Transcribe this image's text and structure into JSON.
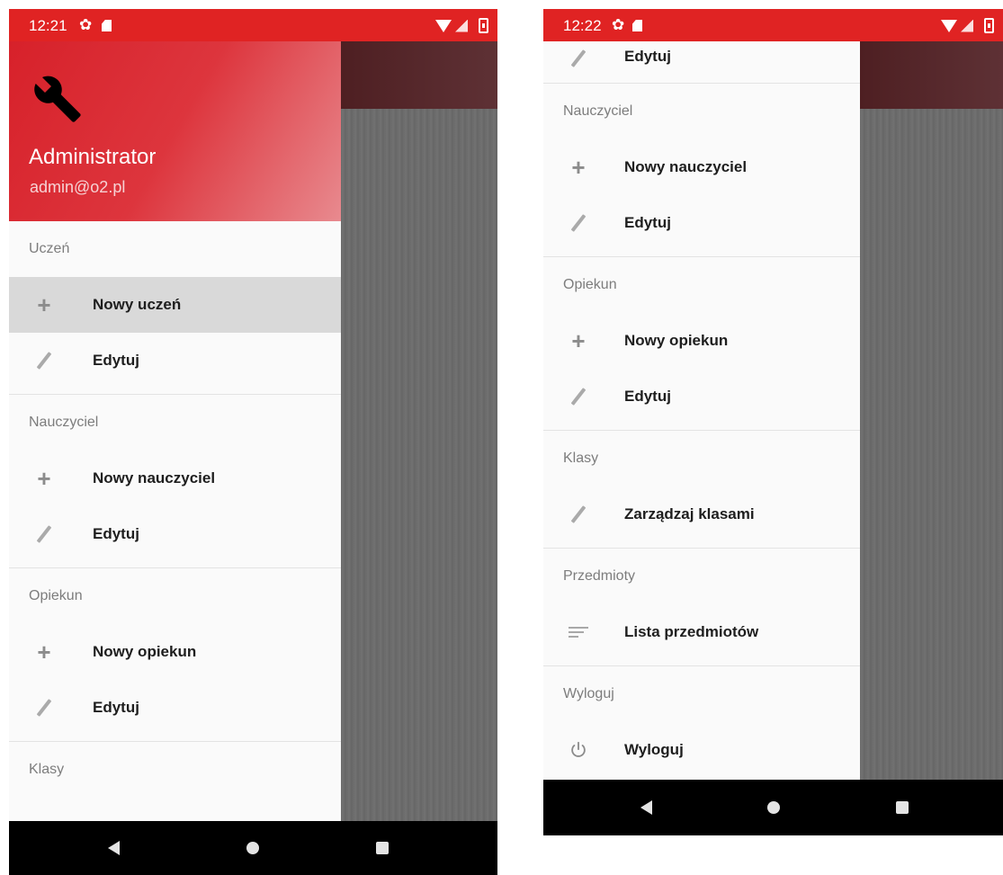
{
  "colors": {
    "status_bar": "#e02323",
    "header_start": "#d7212a",
    "header_end": "#e88a8f",
    "drawer_bg": "#fafafa",
    "selected_item": "#d9d9d9",
    "app_toolbar": "#5e3135",
    "nav_bar": "#000000"
  },
  "left": {
    "status": {
      "time": "12:21",
      "icons": [
        "gear-icon",
        "sd-card-icon",
        "wifi-icon",
        "signal-icon",
        "battery-icon"
      ]
    },
    "header": {
      "icon": "wrench-icon",
      "user_name": "Administrator",
      "user_email": "admin@o2.pl"
    },
    "sections": [
      {
        "title": "Uczeń",
        "items": [
          {
            "label": "Nowy uczeń",
            "icon": "plus-icon",
            "selected": true
          },
          {
            "label": "Edytuj",
            "icon": "pencil-icon"
          }
        ]
      },
      {
        "title": "Nauczyciel",
        "items": [
          {
            "label": "Nowy nauczyciel",
            "icon": "plus-icon"
          },
          {
            "label": "Edytuj",
            "icon": "pencil-icon"
          }
        ]
      },
      {
        "title": "Opiekun",
        "items": [
          {
            "label": "Nowy opiekun",
            "icon": "plus-icon"
          },
          {
            "label": "Edytuj",
            "icon": "pencil-icon"
          }
        ]
      },
      {
        "title": "Klasy"
      }
    ],
    "navbar": {
      "icons": [
        "back-icon",
        "home-icon",
        "recent-apps-icon"
      ]
    }
  },
  "right": {
    "status": {
      "time": "12:22",
      "icons": [
        "gear-icon",
        "sd-card-icon",
        "wifi-icon",
        "signal-icon",
        "battery-icon"
      ]
    },
    "top_item": {
      "label": "Edytuj",
      "icon": "pencil-icon"
    },
    "sections": [
      {
        "title": "Nauczyciel",
        "items": [
          {
            "label": "Nowy nauczyciel",
            "icon": "plus-icon"
          },
          {
            "label": "Edytuj",
            "icon": "pencil-icon"
          }
        ]
      },
      {
        "title": "Opiekun",
        "items": [
          {
            "label": "Nowy opiekun",
            "icon": "plus-icon"
          },
          {
            "label": "Edytuj",
            "icon": "pencil-icon"
          }
        ]
      },
      {
        "title": "Klasy",
        "items": [
          {
            "label": "Zarządzaj klasami",
            "icon": "pencil-icon"
          }
        ]
      },
      {
        "title": "Przedmioty",
        "items": [
          {
            "label": "Lista przedmiotów",
            "icon": "sort-icon"
          }
        ]
      },
      {
        "title": "Wyloguj",
        "items": [
          {
            "label": "Wyloguj",
            "icon": "power-icon"
          }
        ]
      }
    ],
    "navbar": {
      "icons": [
        "back-icon",
        "home-icon",
        "recent-apps-icon"
      ]
    }
  }
}
